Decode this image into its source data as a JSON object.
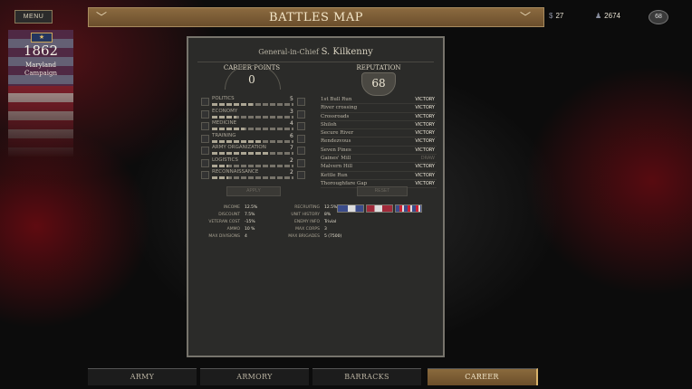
{
  "header": {
    "menu_label": "MENU",
    "title": "BATTLES MAP",
    "money": "27",
    "troops": "2674",
    "reputation_badge": "68"
  },
  "campaign": {
    "year": "1862",
    "name": "Maryland Campaign",
    "rank_icon": "star-icon"
  },
  "general": {
    "title": "General-in-Chief",
    "name": "S. Kilkenny"
  },
  "career_points": {
    "label": "CAREER POINTS",
    "value": "0"
  },
  "reputation": {
    "label": "REPUTATION",
    "value": "68"
  },
  "skills": [
    {
      "name": "POLITICS",
      "value": "5",
      "fill": 0.5
    },
    {
      "name": "ECONOMY",
      "value": "3",
      "fill": 0.3
    },
    {
      "name": "MEDICINE",
      "value": "4",
      "fill": 0.4
    },
    {
      "name": "TRAINING",
      "value": "6",
      "fill": 0.6
    },
    {
      "name": "ARMY ORGANIZATION",
      "value": "7",
      "fill": 0.7
    },
    {
      "name": "LOGISTICS",
      "value": "2",
      "fill": 0.2
    },
    {
      "name": "RECONNAISSANCE",
      "value": "2",
      "fill": 0.2
    }
  ],
  "battles": [
    {
      "name": "1st Bull Run",
      "result": "VICTORY",
      "dim": false
    },
    {
      "name": "River crossing",
      "result": "VICTORY",
      "dim": false
    },
    {
      "name": "Crossroads",
      "result": "VICTORY",
      "dim": false
    },
    {
      "name": "Shiloh",
      "result": "VICTORY",
      "dim": false
    },
    {
      "name": "Secure River",
      "result": "VICTORY",
      "dim": false
    },
    {
      "name": "Rendezvous",
      "result": "VICTORY",
      "dim": false
    },
    {
      "name": "Seven Pines",
      "result": "VICTORY",
      "dim": false
    },
    {
      "name": "Gaines' Mill",
      "result": "DRAW",
      "dim": true
    },
    {
      "name": "Malvern Hill",
      "result": "VICTORY",
      "dim": false
    },
    {
      "name": "Kettle Run",
      "result": "VICTORY",
      "dim": false
    },
    {
      "name": "Thoroughfare Gap",
      "result": "VICTORY",
      "dim": false
    }
  ],
  "buttons": {
    "apply": "APPLY",
    "reset": "RESET"
  },
  "stats_left": [
    {
      "label": "INCOME",
      "value": "12.5%"
    },
    {
      "label": "DISCOUNT",
      "value": "7.5%"
    },
    {
      "label": "VETERAN COST",
      "value": "-15%"
    },
    {
      "label": "AMMO",
      "value": "10 %"
    },
    {
      "label": "MAX DIVISIONS",
      "value": "4"
    }
  ],
  "stats_right": [
    {
      "label": "RECRUITING",
      "value": "12.5%"
    },
    {
      "label": "UNIT HISTORY",
      "value": "8%"
    },
    {
      "label": "ENEMY INFO",
      "value": "Trivial"
    },
    {
      "label": "MAX CORPS",
      "value": "3"
    },
    {
      "label": "MAX BRIGADES",
      "value": "5 (7500)"
    }
  ],
  "tabs": [
    {
      "label": "ARMY",
      "active": false
    },
    {
      "label": "ARMORY",
      "active": false
    },
    {
      "label": "BARRACKS",
      "active": false
    },
    {
      "label": "CAREER",
      "active": true
    }
  ],
  "colors": {
    "accent": "#8b6a3f",
    "active_tab_edge": "#d8b26a"
  }
}
